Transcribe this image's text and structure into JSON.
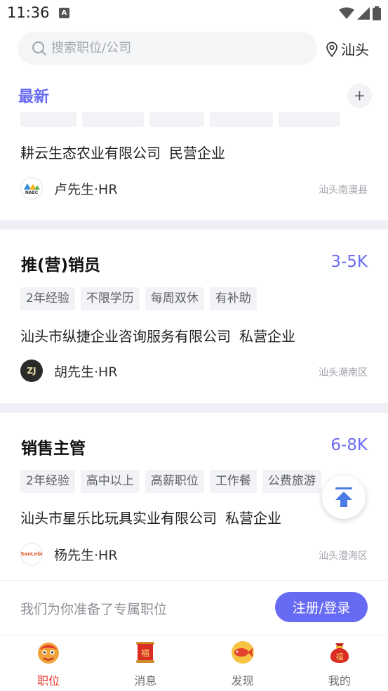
{
  "status_bar": {
    "time": "11:36",
    "notification_badge": "A"
  },
  "search": {
    "placeholder": "搜索职位/公司",
    "location": "汕头"
  },
  "section": {
    "title": "最新"
  },
  "jobs": [
    {
      "title": "",
      "salary": "",
      "tags": [
        "",
        "",
        "",
        "",
        ""
      ],
      "company": "耕云生态农业有限公司",
      "company_type": "民营企业",
      "hr_name": "卢先生·HR",
      "location": "汕头南澳县",
      "avatar_text": "NAEC"
    },
    {
      "title": "推(营)销员",
      "salary": "3-5K",
      "tags": [
        "2年经验",
        "不限学历",
        "每周双休",
        "有补助"
      ],
      "company": "汕头市纵捷企业咨询服务有限公司",
      "company_type": "私营企业",
      "hr_name": "胡先生·HR",
      "location": "汕头潮南区",
      "avatar_text": "ZJ"
    },
    {
      "title": "销售主管",
      "salary": "6-8K",
      "tags": [
        "2年经验",
        "高中以上",
        "高薪职位",
        "工作餐",
        "公费旅游"
      ],
      "company": "汕头市星乐比玩具实业有限公司",
      "company_type": "私营企业",
      "hr_name": "杨先生·HR",
      "location": "汕头澄海区",
      "avatar_text": "SanLebi"
    }
  ],
  "promo": {
    "text": "我们为你准备了专属职位",
    "button": "注册/登录"
  },
  "nav": [
    {
      "label": "职位",
      "icon": "lion-dance-icon",
      "active": true
    },
    {
      "label": "消息",
      "icon": "fu-scroll-icon",
      "active": false
    },
    {
      "label": "发现",
      "icon": "koi-fish-icon",
      "active": false
    },
    {
      "label": "我的",
      "icon": "fu-bag-icon",
      "active": false
    }
  ],
  "colors": {
    "accent": "#676af2",
    "active_nav": "#e8312a",
    "divider": "#eef0f6"
  }
}
